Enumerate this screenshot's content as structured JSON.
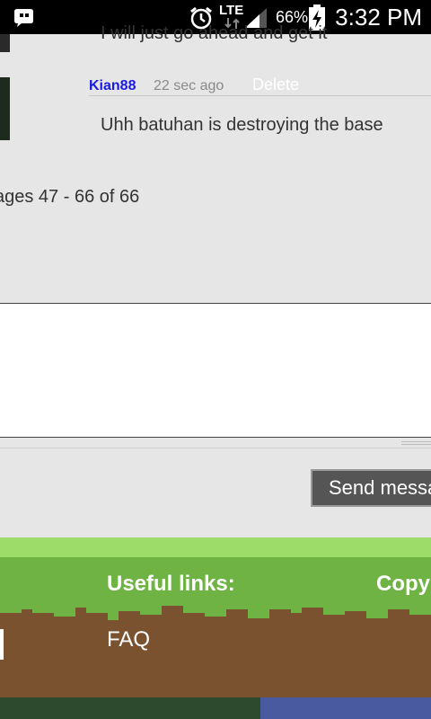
{
  "status_bar": {
    "network": "LTE",
    "battery_percent": "66%",
    "time": "3:32 PM"
  },
  "chat": {
    "messages": [
      {
        "text": "I will just go ahead and get it"
      },
      {
        "username": "Kian88",
        "time_ago": "22 sec ago",
        "delete_label": "Delete",
        "text": "Uhh batuhan is destroying the base"
      }
    ],
    "pager_text": "ages 47 - 66 of 66"
  },
  "composer": {
    "send_label": "Send messa"
  },
  "footer": {
    "useful_links_heading": "Useful links:",
    "copy_heading": "Copy",
    "faq_label": "FAQ"
  },
  "colors": {
    "username": "#1a1ae6",
    "grass": "#6fb344",
    "dirt": "#7a5230"
  }
}
